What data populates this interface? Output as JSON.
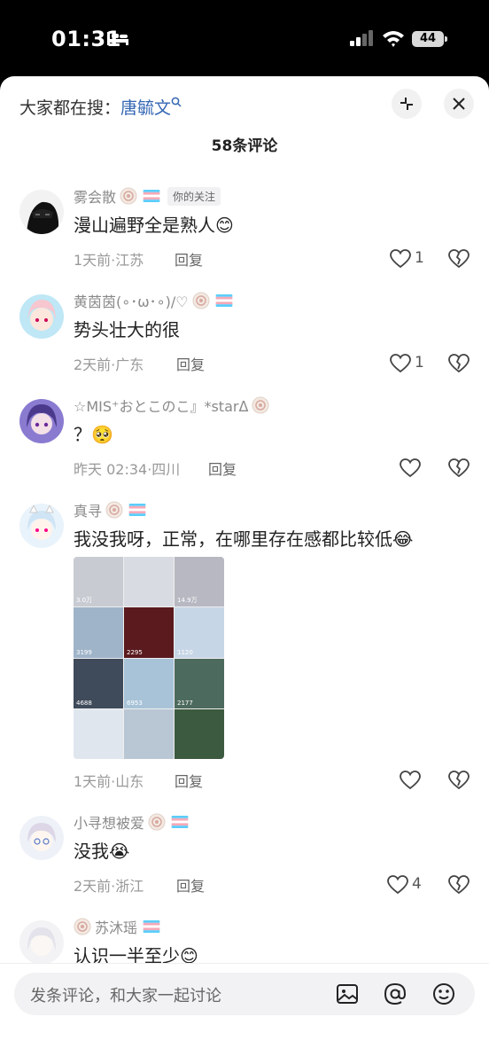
{
  "status_bar": {
    "time": "01:31",
    "battery": "44"
  },
  "header": {
    "search_prefix": "大家都在搜：",
    "search_keyword": "唐毓文",
    "comment_count": "58条评论"
  },
  "comments": [
    {
      "name": "雾会散",
      "follow_tag": "你的关注",
      "text": "漫山遍野全是熟人😊",
      "meta": "1天前·江苏",
      "reply": "回复",
      "likes": "1"
    },
    {
      "name": "黄茵茵(∘･ω･∘)/♡",
      "text": "势头壮大的很",
      "meta": "2天前·广东",
      "reply": "回复",
      "likes": "1"
    },
    {
      "name": "☆MIS⁺おとこのこ』*starᐃ",
      "text": "？🥺",
      "meta": "昨天 02:34·四川",
      "reply": "回复",
      "likes": ""
    },
    {
      "name": "真寻",
      "text": "我没我呀，正常，在哪里存在感都比较低😂",
      "meta": "1天前·山东",
      "reply": "回复",
      "likes": "",
      "photos": [
        "3.0万",
        "",
        "14.9万",
        "3199",
        "2295",
        "1120",
        "4688",
        "6953",
        "2177",
        "",
        "",
        ""
      ]
    },
    {
      "name": "小寻想被爱",
      "text": "没我😭",
      "meta": "2天前·浙江",
      "reply": "回复",
      "likes": "4"
    },
    {
      "name": "苏沐瑶",
      "text": "认识一半至少😊",
      "meta": "",
      "reply": "",
      "likes": ""
    }
  ],
  "input": {
    "placeholder": "发条评论，和大家一起讨论"
  },
  "colors": {
    "keyword": "#3467b4",
    "meta": "#999999",
    "name": "#8a8a8a"
  }
}
